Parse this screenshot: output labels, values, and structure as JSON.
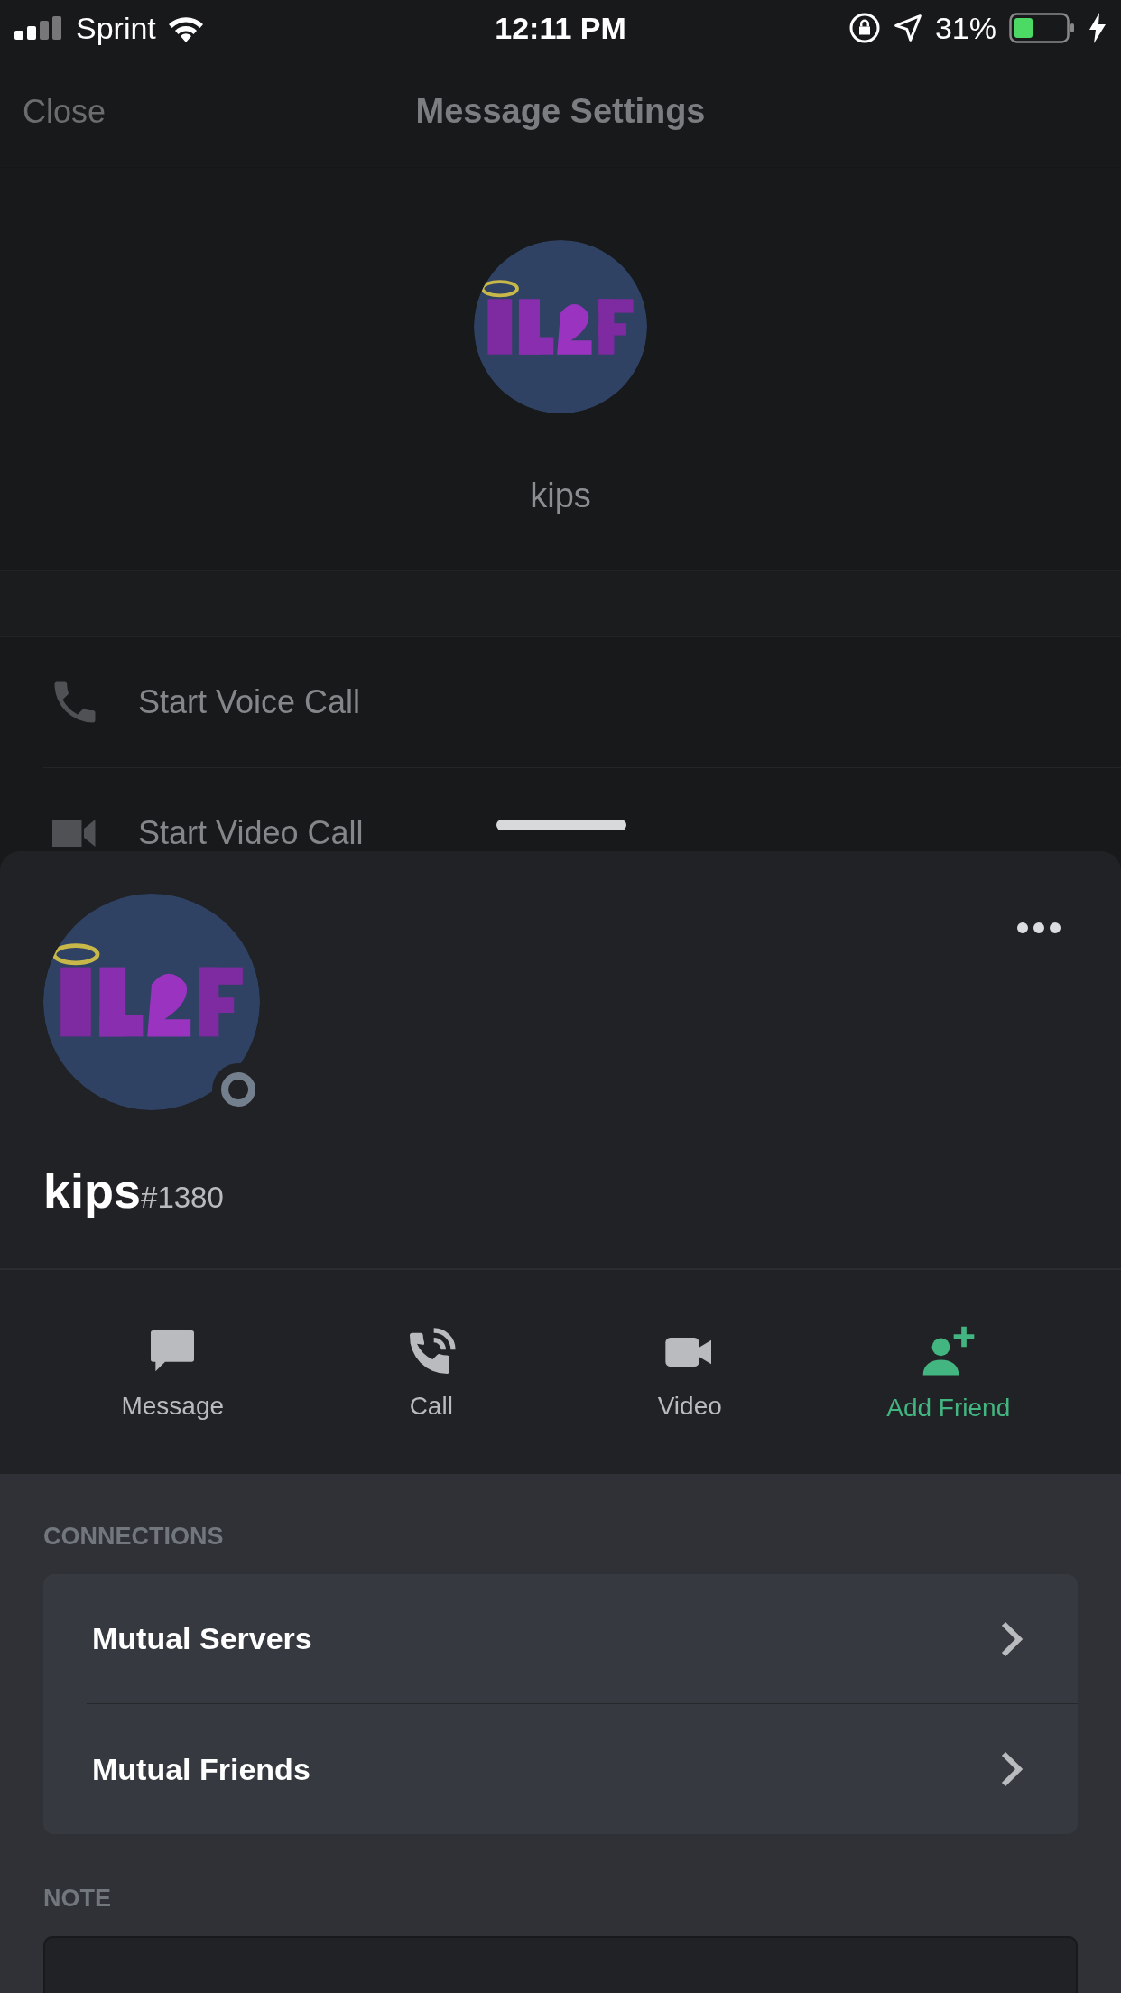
{
  "status_bar": {
    "carrier": "Sprint",
    "time": "12:11 PM",
    "battery_percent": "31%"
  },
  "nav": {
    "close": "Close",
    "title": "Message Settings"
  },
  "dm_header": {
    "username": "kips"
  },
  "menu_rows": [
    {
      "kind": "voice",
      "label": "Start Voice Call"
    },
    {
      "kind": "video",
      "label": "Start Video Call"
    }
  ],
  "profile": {
    "username": "kips",
    "discriminator": "#1380",
    "actions": [
      {
        "kind": "message",
        "label": "Message",
        "accent": false
      },
      {
        "kind": "call",
        "label": "Call",
        "accent": false
      },
      {
        "kind": "video",
        "label": "Video",
        "accent": false
      },
      {
        "kind": "add_friend",
        "label": "Add Friend",
        "accent": true
      }
    ],
    "connections": {
      "heading": "CONNECTIONS",
      "items": [
        {
          "label": "Mutual Servers"
        },
        {
          "label": "Mutual Friends"
        }
      ]
    },
    "note": {
      "heading": "NOTE"
    }
  }
}
